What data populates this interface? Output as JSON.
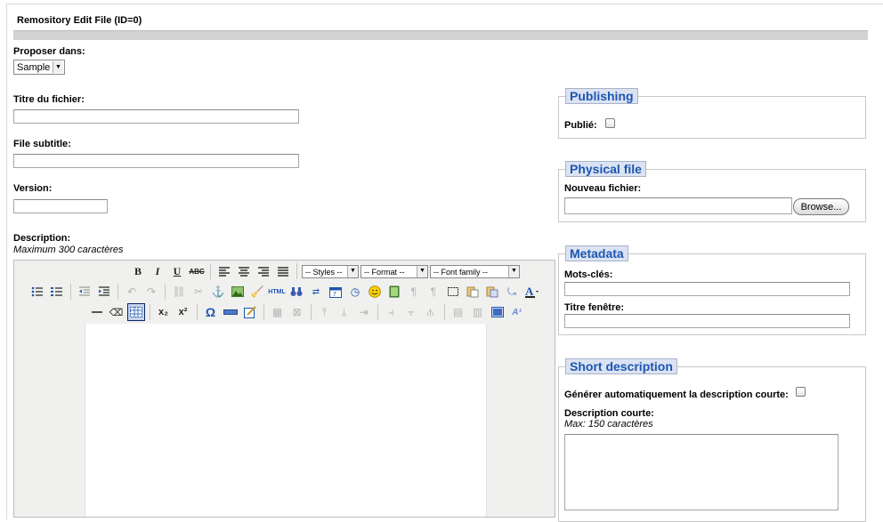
{
  "page": {
    "title": "Remository Edit File (ID=0)"
  },
  "form": {
    "proposer_label": "Proposer dans:",
    "proposer_value": "Sample",
    "titre_label": "Titre du fichier:",
    "titre_value": "",
    "subtitle_label": "File subtitle:",
    "subtitle_value": "",
    "version_label": "Version:",
    "version_value": "",
    "description_label": "Description:",
    "description_hint": "Maximum 300 caractères"
  },
  "editor": {
    "row1": [
      "B",
      "I",
      "U",
      "ABC"
    ],
    "styles": "-- Styles --",
    "format": "-- Format --",
    "font_family": "-- Font family --",
    "html_label": "HTML",
    "omega": "Ω",
    "sub": "x₂",
    "sup": "x²"
  },
  "publishing": {
    "legend": "Publishing",
    "publie_label": "Publié:",
    "publie_checked": false
  },
  "physical": {
    "legend": "Physical file",
    "nouveau_label": "Nouveau fichier:",
    "browse_label": "Browse..."
  },
  "metadata": {
    "legend": "Metadata",
    "keywords_label": "Mots-clés:",
    "window_title_label": "Titre fenêtre:"
  },
  "short_desc": {
    "legend": "Short description",
    "auto_label": "Générer automatiquement la description courte:",
    "auto_checked": false,
    "desc_label": "Description courte:",
    "desc_hint": "Max: 150 caractères"
  },
  "colors": {
    "legend_blue": "#1d56b0",
    "legend_bg": "#dbe3f3",
    "title_bar": "#d2d2d2"
  }
}
